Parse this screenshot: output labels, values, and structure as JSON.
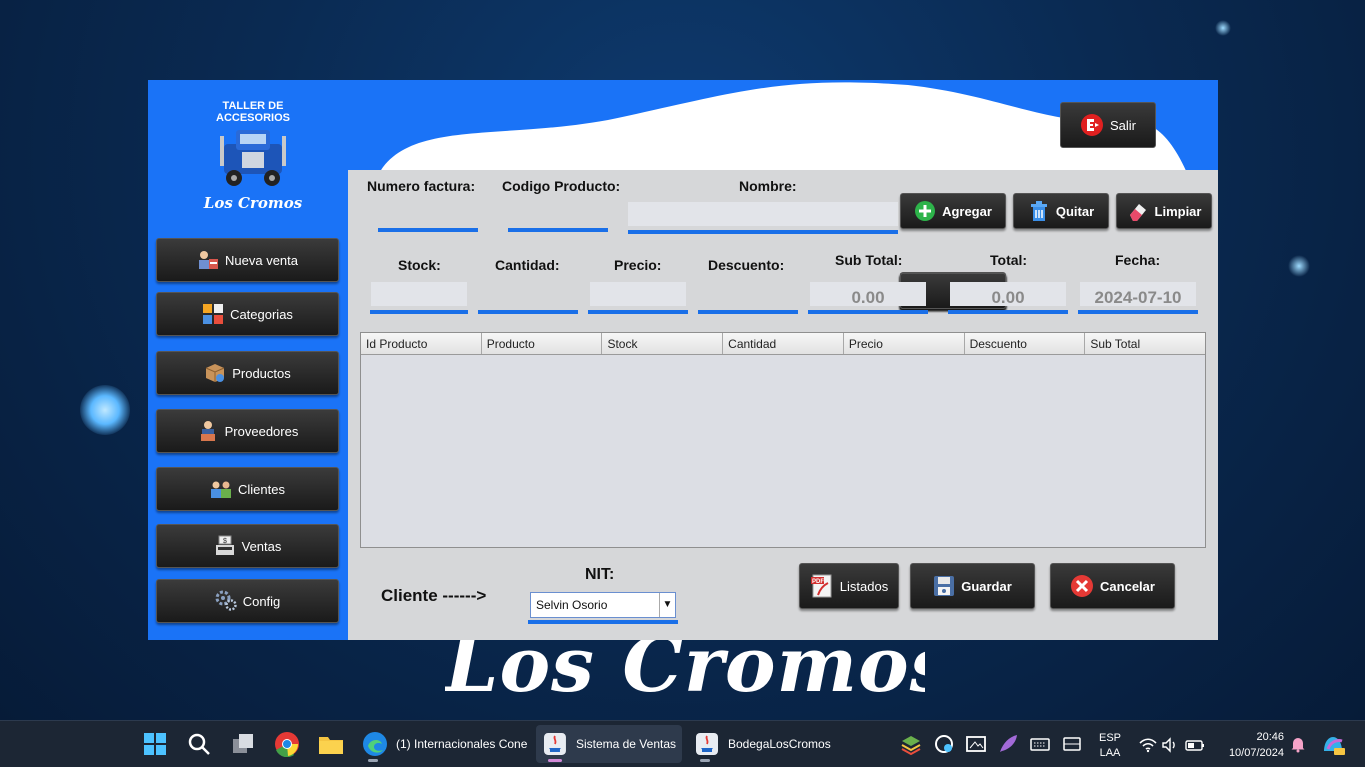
{
  "app": {
    "logo_top_text": "TALLER DE ACCESORIOS",
    "logo_bottom_text": "Los Cromos",
    "salir_label": "Salir"
  },
  "sidebar": {
    "items": [
      {
        "label": "Nueva venta"
      },
      {
        "label": "Categorias"
      },
      {
        "label": "Productos"
      },
      {
        "label": "Proveedores"
      },
      {
        "label": "Clientes"
      },
      {
        "label": "Ventas"
      },
      {
        "label": "Config"
      }
    ]
  },
  "form": {
    "numero_factura_label": "Numero factura:",
    "codigo_producto_label": "Codigo Producto:",
    "nombre_label": "Nombre:",
    "stock_label": "Stock:",
    "cantidad_label": "Cantidad:",
    "precio_label": "Precio:",
    "descuento_label": "Descuento:",
    "subtotal_label": "Sub Total:",
    "total_label": "Total:",
    "fecha_label": "Fecha:",
    "subtotal_value": "0.00",
    "total_value": "0.00",
    "fecha_value": "2024-07-10"
  },
  "actions": {
    "agregar": "Agregar",
    "quitar": "Quitar",
    "limpiar": "Limpiar",
    "listados": "Listados",
    "guardar": "Guardar",
    "cancelar": "Cancelar"
  },
  "table": {
    "columns": [
      "Id Producto",
      "Producto",
      "Stock",
      "Cantidad",
      "Precio",
      "Descuento",
      "Sub Total"
    ]
  },
  "client": {
    "cliente_label": "Cliente ------>",
    "nit_label": "NIT:",
    "selected": "Selvin Osorio"
  },
  "background": {
    "brand_text": "Los Cromos"
  },
  "taskbar": {
    "apps": [
      {
        "label": "(1) Internacionales Cone"
      },
      {
        "label": "Sistema de Ventas"
      },
      {
        "label": "BodegaLosCromos"
      }
    ],
    "lang_top": "ESP",
    "lang_bottom": "LAA",
    "time": "20:46",
    "date": "10/07/2024"
  },
  "colors": {
    "accent_blue": "#1a73f7",
    "panel_gray": "#d6d7d9",
    "button_dark": "#1a1a1a"
  }
}
